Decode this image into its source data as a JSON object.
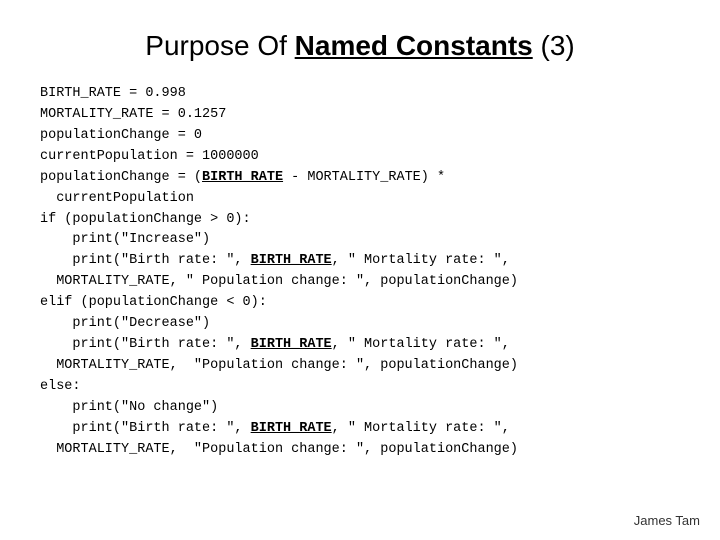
{
  "title": {
    "prefix": "Purpose Of ",
    "named": "Named Constants",
    "suffix": " (3)"
  },
  "code": {
    "lines": [
      {
        "type": "plain",
        "text": "BIRTH_RATE = 0.998"
      },
      {
        "type": "plain",
        "text": "MORTALITY_RATE = 0.1257"
      },
      {
        "type": "plain",
        "text": "populationChange = 0"
      },
      {
        "type": "plain",
        "text": "currentPopulation = 1000000"
      },
      {
        "type": "mixed",
        "parts": [
          {
            "text": "populationChange = (",
            "style": "plain"
          },
          {
            "text": "BIRTH_RATE",
            "style": "highlight"
          },
          {
            "text": " - MORTALITY_RATE) *",
            "style": "plain"
          }
        ]
      },
      {
        "type": "plain",
        "text": "  currentPopulation"
      },
      {
        "type": "plain",
        "text": "if (populationChange > 0):"
      },
      {
        "type": "plain",
        "text": "    print(\"Increase\")"
      },
      {
        "type": "mixed",
        "parts": [
          {
            "text": "    print(\"Birth rate: \", ",
            "style": "plain"
          },
          {
            "text": "BIRTH_RATE",
            "style": "highlight"
          },
          {
            "text": ", \" Mortality rate: \",",
            "style": "plain"
          }
        ]
      },
      {
        "type": "plain",
        "text": "  MORTALITY_RATE, \" Population change: \", populationChange)"
      },
      {
        "type": "plain",
        "text": "elif (populationChange < 0):"
      },
      {
        "type": "plain",
        "text": "    print(\"Decrease\")"
      },
      {
        "type": "mixed",
        "parts": [
          {
            "text": "    print(\"Birth rate: \", ",
            "style": "plain"
          },
          {
            "text": "BIRTH_RATE",
            "style": "highlight"
          },
          {
            "text": ", \" Mortality rate: \",",
            "style": "plain"
          }
        ]
      },
      {
        "type": "plain",
        "text": "  MORTALITY_RATE,  \"Population change: \", populationChange)"
      },
      {
        "type": "plain",
        "text": "else:"
      },
      {
        "type": "plain",
        "text": "    print(\"No change\")"
      },
      {
        "type": "mixed",
        "parts": [
          {
            "text": "    print(\"Birth rate: \", ",
            "style": "plain"
          },
          {
            "text": "BIRTH_RATE",
            "style": "highlight"
          },
          {
            "text": ", \" Mortality rate: \",",
            "style": "plain"
          }
        ]
      },
      {
        "type": "plain",
        "text": "  MORTALITY_RATE,  \"Population change: \", populationChange)"
      }
    ]
  },
  "footer": {
    "author": "James Tam"
  }
}
